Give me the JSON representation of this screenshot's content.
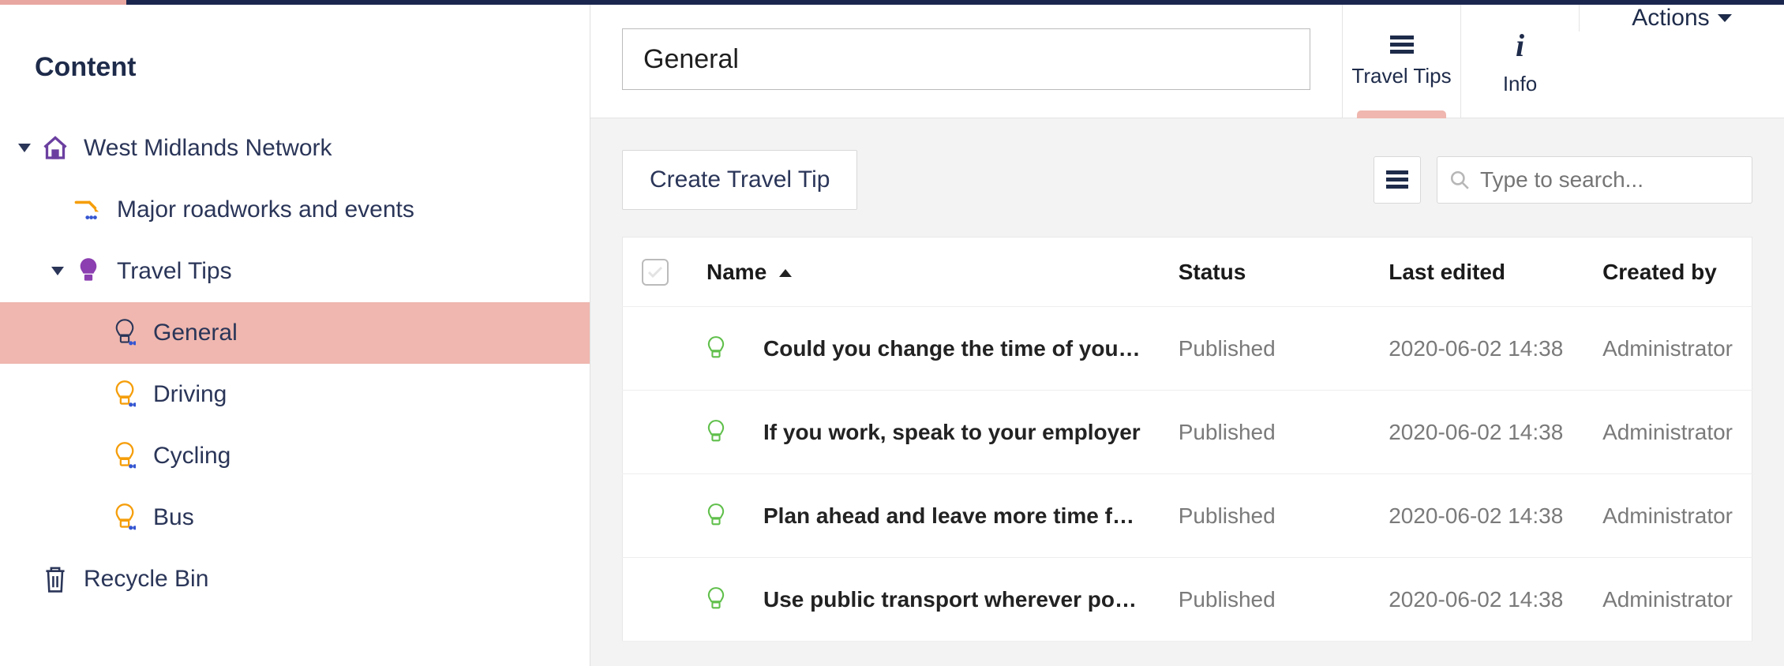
{
  "sidebar": {
    "title": "Content",
    "nodes": {
      "root": "West Midlands Network",
      "roadworks": "Major roadworks and events",
      "traveltips": "Travel Tips",
      "general": "General",
      "driving": "Driving",
      "cycling": "Cycling",
      "bus": "Bus",
      "recycle": "Recycle Bin"
    }
  },
  "header": {
    "title_value": "General",
    "tabs": {
      "tips": "Travel Tips",
      "info": "Info"
    },
    "actions": "Actions"
  },
  "toolbar": {
    "create_label": "Create Travel Tip",
    "search_placeholder": "Type to search..."
  },
  "columns": {
    "name": "Name",
    "status": "Status",
    "edited": "Last edited",
    "created_by": "Created by"
  },
  "rows": [
    {
      "name": "Could you change the time of you…",
      "status": "Published",
      "edited": "2020-06-02 14:38",
      "author": "Administrator"
    },
    {
      "name": "If you work, speak to your employer",
      "status": "Published",
      "edited": "2020-06-02 14:38",
      "author": "Administrator"
    },
    {
      "name": "Plan ahead and leave more time f…",
      "status": "Published",
      "edited": "2020-06-02 14:38",
      "author": "Administrator"
    },
    {
      "name": "Use public transport wherever po…",
      "status": "Published",
      "edited": "2020-06-02 14:38",
      "author": "Administrator"
    }
  ],
  "colors": {
    "accent_pink": "#efb7af",
    "purple": "#6b3fa0",
    "orange": "#f59e0b",
    "green": "#5fbf4a",
    "navy": "#1e2b4a"
  }
}
